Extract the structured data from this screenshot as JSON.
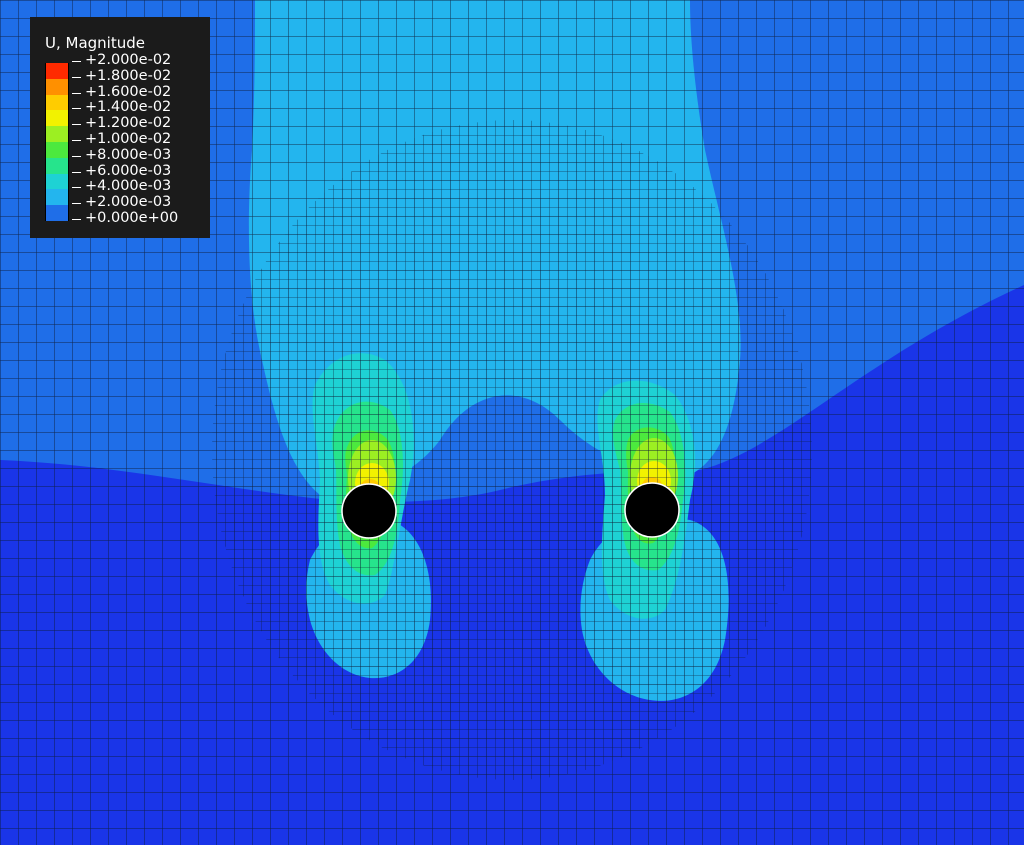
{
  "legend": {
    "title": "U, Magnitude",
    "levels": [
      {
        "label": "+2.000e-02",
        "color": "#ff2a00"
      },
      {
        "label": "+1.800e-02",
        "color": "#ff9000"
      },
      {
        "label": "+1.600e-02",
        "color": "#ffcc00"
      },
      {
        "label": "+1.400e-02",
        "color": "#f2f200"
      },
      {
        "label": "+1.200e-02",
        "color": "#9cef22"
      },
      {
        "label": "+1.000e-02",
        "color": "#4ce93e"
      },
      {
        "label": "+8.000e-03",
        "color": "#26e48c"
      },
      {
        "label": "+6.000e-03",
        "color": "#1ed2d4"
      },
      {
        "label": "+4.000e-03",
        "color": "#23b5ee"
      },
      {
        "label": "+2.000e-03",
        "color": "#1f6ee8"
      },
      {
        "label": "+0.000e+00",
        "color": "#1a35e8"
      }
    ]
  },
  "contour_colors": {
    "background": "#1f6ee8",
    "zero_band": "#1a35e8",
    "level_4e-3": "#23b5ee",
    "level_6e-3": "#1ed2d4",
    "level_8e-3": "#26e48c",
    "level_1e-2": "#4ce93e",
    "level_1_2e-2": "#9cef22",
    "level_1_4e-2": "#f2f200",
    "level_1_6e-2": "#ffcc00",
    "mesh_line": "#0d1a33",
    "hole": "#000000"
  }
}
